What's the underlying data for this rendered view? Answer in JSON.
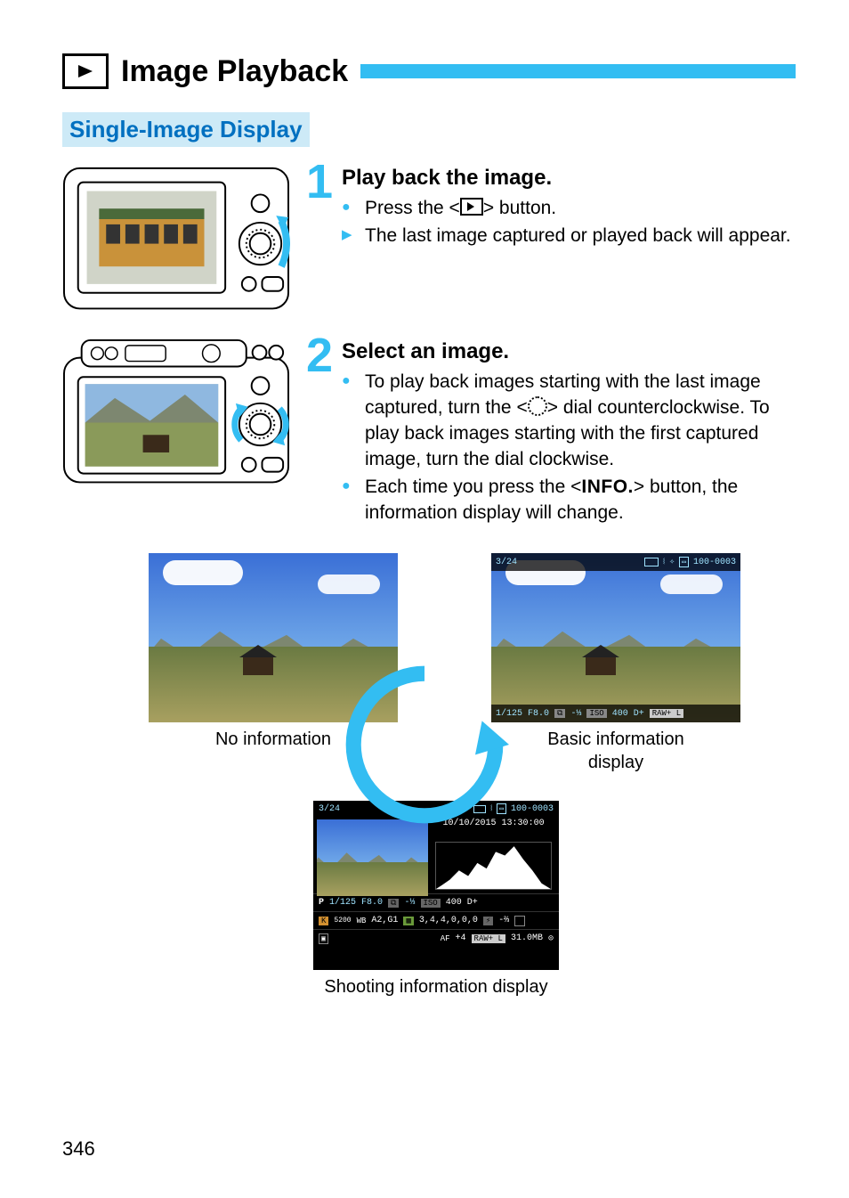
{
  "title": "Image Playback",
  "subheading": "Single-Image Display",
  "step1": {
    "number": "1",
    "heading": "Play back the image.",
    "line1_a": "Press the <",
    "line1_b": "> button.",
    "line2": "The last image captured or played back will appear."
  },
  "step2": {
    "number": "2",
    "heading": "Select an image.",
    "line1_a": "To play back images starting with the last image captured, turn the <",
    "line1_b": "> dial counterclockwise. To play back images starting with the first captured image, turn the dial clockwise.",
    "line2_a": "Each time you press the <",
    "line2_info": "INFO.",
    "line2_b": "> button, the information display will change."
  },
  "screens": {
    "noinfo_caption": "No information",
    "basic_caption_l1": "Basic information",
    "basic_caption_l2": "display",
    "shooting_caption": "Shooting information display",
    "basic_top_left": "3/24",
    "basic_top_right": "100-0003",
    "basic_bot_shutter": "1/125",
    "basic_bot_aperture": "F8.0",
    "basic_bot_comp": "-⅓",
    "basic_bot_iso": "400",
    "basic_bot_iso_badge": "ISO",
    "basic_bot_dplus": "D+",
    "basic_bot_raw": "RAW+ L",
    "shoot_top_left": "3/24",
    "shoot_top_right": "100-0003",
    "shoot_date": "10/10/2015 13:30:00",
    "shoot_r1_mode": "P",
    "shoot_r1_shutter": "1/125",
    "shoot_r1_aperture": "F8.0",
    "shoot_r1_comp": "-⅓",
    "shoot_r1_iso_badge": "ISO",
    "shoot_r1_iso": "400",
    "shoot_r1_dplus": "D+",
    "shoot_r2_k": "5200",
    "shoot_r2_wb": "A2,G1",
    "shoot_r2_style": "3,4,4,0,0,0",
    "shoot_r2_flash": "-⅔",
    "shoot_r3_af": "+4",
    "shoot_r3_raw": "RAW+ L",
    "shoot_r3_size": "31.0MB"
  },
  "page_number": "346"
}
